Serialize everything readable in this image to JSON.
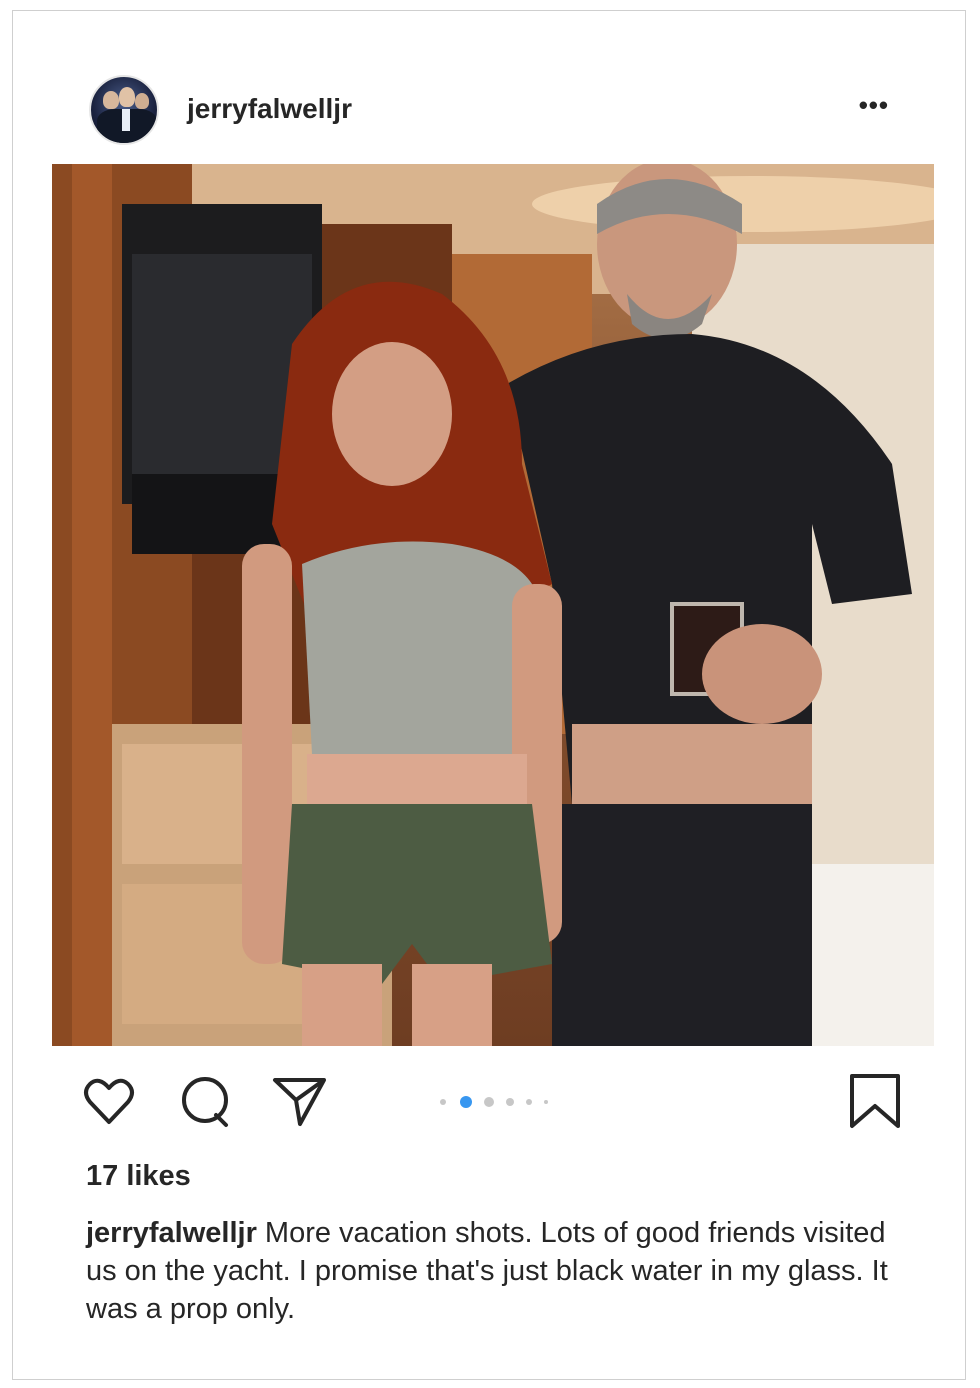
{
  "post": {
    "username": "jerryfalwelljr",
    "more_label": "•••",
    "carousel": {
      "count": 6,
      "active_index": 1
    },
    "likes": "17 likes",
    "caption_user": "jerryfalwelljr",
    "caption_text": " More vacation shots.  Lots of good friends visited us on the yacht.  I promise that's just black water in my glass.  It was a prop only."
  },
  "icons": {
    "like": "heart-icon",
    "comment": "comment-icon",
    "share": "send-icon",
    "save": "bookmark-icon",
    "more": "more-options-icon"
  },
  "colors": {
    "text": "#262626",
    "carousel_active": "#3897f0",
    "carousel_inactive": "#c7c7c7"
  }
}
